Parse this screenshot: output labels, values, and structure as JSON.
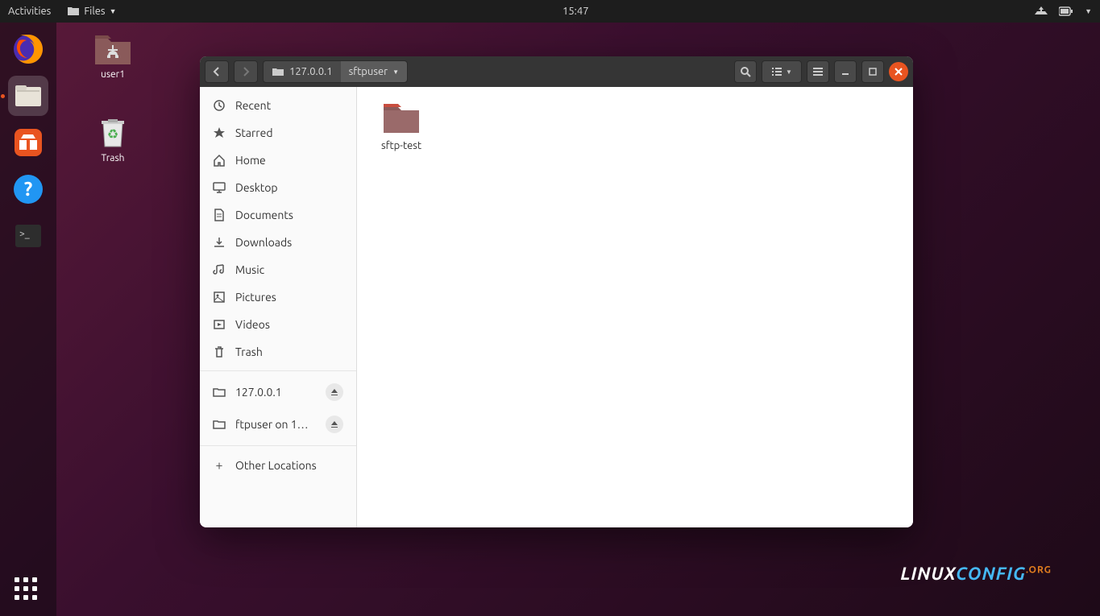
{
  "topbar": {
    "activities": "Activities",
    "app_menu": "Files",
    "clock": "15:47"
  },
  "desktop": {
    "icons": [
      {
        "name": "user1",
        "type": "folder"
      },
      {
        "name": "Trash",
        "type": "trash"
      }
    ]
  },
  "window": {
    "path": {
      "host": "127.0.0.1",
      "folder": "sftpuser"
    },
    "sidebar": {
      "places": [
        {
          "label": "Recent",
          "icon": "clock"
        },
        {
          "label": "Starred",
          "icon": "star"
        },
        {
          "label": "Home",
          "icon": "home"
        },
        {
          "label": "Desktop",
          "icon": "desktop"
        },
        {
          "label": "Documents",
          "icon": "document"
        },
        {
          "label": "Downloads",
          "icon": "download"
        },
        {
          "label": "Music",
          "icon": "music"
        },
        {
          "label": "Pictures",
          "icon": "picture"
        },
        {
          "label": "Videos",
          "icon": "video"
        },
        {
          "label": "Trash",
          "icon": "trash"
        }
      ],
      "mounts": [
        {
          "label": "127.0.0.1",
          "ejectable": true
        },
        {
          "label": "ftpuser on 1…",
          "ejectable": true
        }
      ],
      "other": {
        "label": "Other Locations"
      }
    },
    "files": [
      {
        "name": "sftp-test",
        "type": "folder"
      }
    ]
  },
  "branding": {
    "text1": "LINUX",
    "text2": "CONFIG",
    "text3": ".ORG"
  }
}
